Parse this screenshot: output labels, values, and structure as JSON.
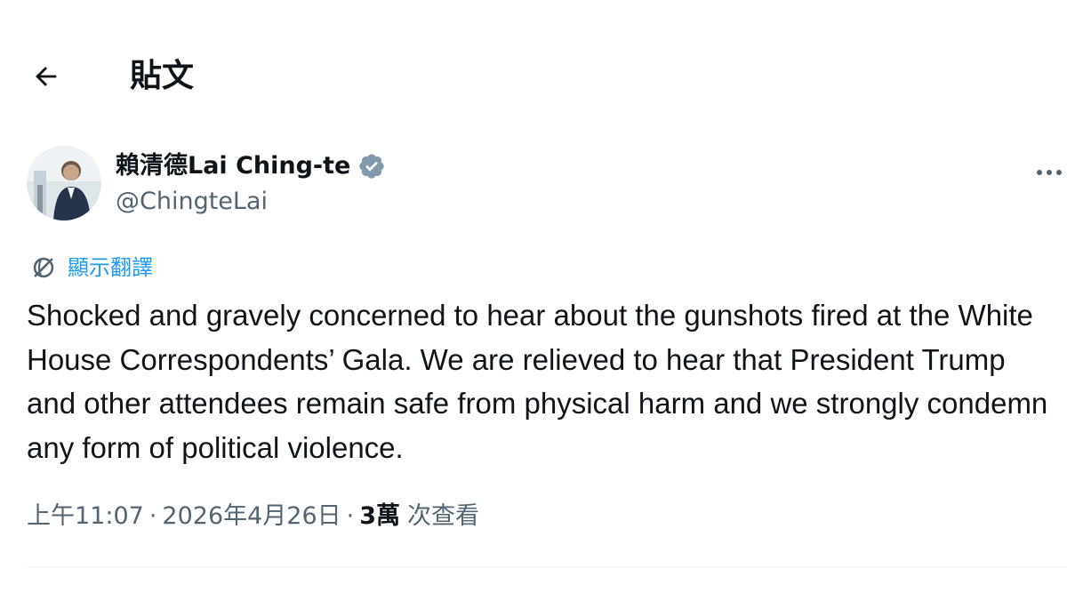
{
  "header": {
    "title": "貼文",
    "back_icon": "arrow-left-icon"
  },
  "author": {
    "display_name": "賴清德Lai Ching-te",
    "handle": "@ChingteLai",
    "verified": true,
    "verified_color": "#829aab",
    "avatar_icon": "profile-photo"
  },
  "translate": {
    "label": "顯示翻譯",
    "icon": "globe-icon",
    "color": "#1d9bf0"
  },
  "tweet": {
    "text": "Shocked and gravely concerned to hear about the gunshots fired at the White House Correspondents’ Gala. We are relieved to hear that President Trump and other attendees remain safe from physical harm and we strongly condemn any form of political violence."
  },
  "meta": {
    "time": "上午11:07",
    "separator": "·",
    "date": "2026年4月26日",
    "views_count": "3萬",
    "views_label": "次查看"
  },
  "more_icon": "more-horizontal-icon"
}
